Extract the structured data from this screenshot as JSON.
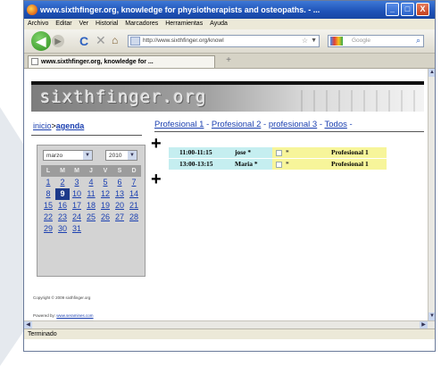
{
  "window": {
    "title": "www.sixthfinger.org, knowledge for physiotherapists and osteopaths. - ...",
    "controls": {
      "minimize": "_",
      "maximize": "□",
      "close": "X"
    }
  },
  "menu": [
    "Archivo",
    "Editar",
    "Ver",
    "Historial",
    "Marcadores",
    "Herramientas",
    "Ayuda"
  ],
  "nav": {
    "url": "http://www.sixthfinger.org/knowl",
    "search_placeholder": "Google"
  },
  "tab": {
    "label": "www.sixthfinger.org, knowledge for ...",
    "new_tab": "+"
  },
  "site": {
    "logo": "sixthfinger.org",
    "breadcrumb": {
      "home": "inicio",
      "sep": ">",
      "current": "agenda"
    },
    "professionals": [
      "Profesional 1",
      "Profesional 2",
      "profesional 3",
      "Todos"
    ],
    "add_symbol": "+"
  },
  "calendar": {
    "month": "marzo",
    "year": "2010",
    "weekdays": [
      "L",
      "M",
      "M",
      "J",
      "V",
      "S",
      "D"
    ],
    "weeks": [
      [
        "1",
        "2",
        "3",
        "4",
        "5",
        "6",
        "7"
      ],
      [
        "8",
        "9",
        "10",
        "11",
        "12",
        "13",
        "14"
      ],
      [
        "15",
        "16",
        "17",
        "18",
        "19",
        "20",
        "21"
      ],
      [
        "22",
        "23",
        "24",
        "25",
        "26",
        "27",
        "28"
      ],
      [
        "29",
        "30",
        "31",
        "",
        "",
        "",
        ""
      ]
    ],
    "selected_day": "9"
  },
  "appointments": [
    {
      "time": "11:00-11:15",
      "patient": "jose *",
      "flag": "*",
      "professional": "Profesional 1"
    },
    {
      "time": "13:00-13:15",
      "patient": "Maria *",
      "flag": "*",
      "professional": "Profesional 1"
    }
  ],
  "footer": {
    "copyright": "Copyright © 2009 sixthfinger.org",
    "powered_label": "Powered by:",
    "powered_link": "www.seramines.com"
  },
  "status": "Terminado"
}
